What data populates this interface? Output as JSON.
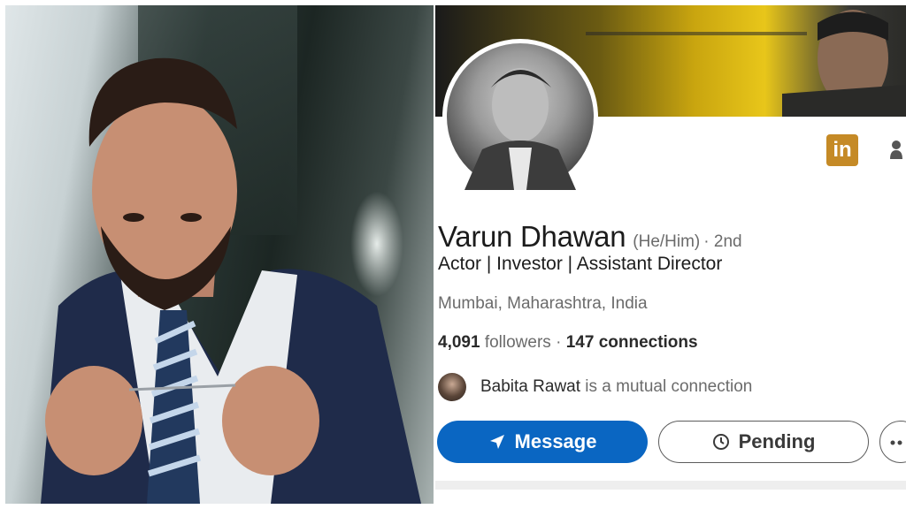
{
  "profile": {
    "name": "Varun Dhawan",
    "pronouns": "(He/Him)",
    "degree": "· 2nd",
    "headline": "Actor | Investor | Assistant Director",
    "location": "Mumbai, Maharashtra, India",
    "followers_count": "4,091",
    "followers_label": "followers",
    "separator": " · ",
    "connections_count": "147",
    "connections_label": "connections",
    "mutual_name": "Babita Rawat",
    "mutual_suffix": " is a mutual connection",
    "brand_badge": "in",
    "brand_color": "#c58a26"
  },
  "actions": {
    "message_label": "Message",
    "pending_label": "Pending",
    "message_color": "#0a66c2"
  },
  "icons": {
    "send": "send-icon",
    "clock": "clock-icon",
    "more": "more-horizontal-icon",
    "person": "person-icon"
  }
}
